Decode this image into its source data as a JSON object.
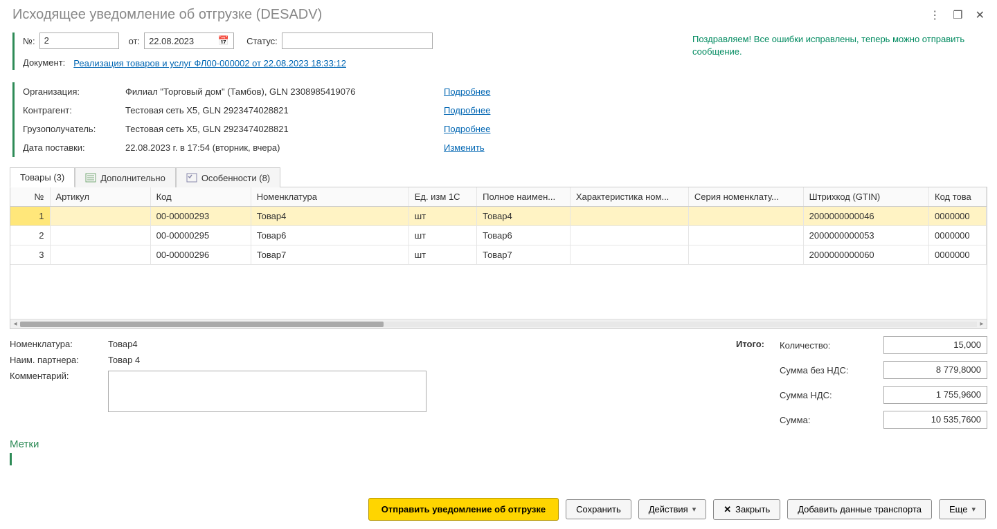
{
  "window": {
    "title": "Исходящее уведомление об отгрузке (DESADV)"
  },
  "header": {
    "num_label": "№:",
    "num_value": "2",
    "from_label": "от:",
    "date_value": "22.08.2023",
    "status_label": "Статус:",
    "status_value": "",
    "congrat": "Поздравляем! Все ошибки исправлены, теперь можно отправить сообщение."
  },
  "doc": {
    "label": "Документ:",
    "link": "Реализация товаров и услуг ФЛ00-000002 от 22.08.2023 18:33:12"
  },
  "info": {
    "org_label": "Организация:",
    "org_value": "Филиал \"Торговый дом\" (Тамбов), GLN 2308985419076",
    "counter_label": "Контрагент:",
    "counter_value": "Тестовая сеть X5, GLN 2923474028821",
    "consignee_label": "Грузополучатель:",
    "consignee_value": "Тестовая сеть X5, GLN 2923474028821",
    "delivery_label": "Дата поставки:",
    "delivery_value": "22.08.2023 г. в 17:54 (вторник, вчера)",
    "more": "Подробнее",
    "change": "Изменить"
  },
  "tabs": {
    "goods": "Товары (3)",
    "extra": "Дополнительно",
    "features": "Особенности (8)"
  },
  "table": {
    "cols": [
      "№",
      "Артикул",
      "Код",
      "Номенклатура",
      "Ед. изм 1С",
      "Полное наимен...",
      "Характеристика ном...",
      "Серия номенклату...",
      "Штрихкод (GTIN)",
      "Код това"
    ],
    "rows": [
      {
        "n": "1",
        "art": "",
        "code": "00-00000293",
        "nom": "Товар4",
        "unit": "шт",
        "full": "Товар4",
        "char": "",
        "series": "",
        "gtin": "2000000000046",
        "pcode": "0000000"
      },
      {
        "n": "2",
        "art": "",
        "code": "00-00000295",
        "nom": "Товар6",
        "unit": "шт",
        "full": "Товар6",
        "char": "",
        "series": "",
        "gtin": "2000000000053",
        "pcode": "0000000"
      },
      {
        "n": "3",
        "art": "",
        "code": "00-00000296",
        "nom": "Товар7",
        "unit": "шт",
        "full": "Товар7",
        "char": "",
        "series": "",
        "gtin": "2000000000060",
        "pcode": "0000000"
      }
    ]
  },
  "bottom": {
    "nom_label": "Номенклатура:",
    "nom_value": "Товар4",
    "partner_label": "Наим. партнера:",
    "partner_value": "Товар 4",
    "comment_label": "Комментарий:",
    "comment_value": ""
  },
  "totals": {
    "title": "Итого:",
    "qty_label": "Количество:",
    "qty_value": "15,000",
    "sum_novat_label": "Сумма без НДС:",
    "sum_novat_value": "8 779,8000",
    "vat_label": "Сумма НДС:",
    "vat_value": "1 755,9600",
    "sum_label": "Сумма:",
    "sum_value": "10 535,7600"
  },
  "labels_section": {
    "title": "Метки"
  },
  "footer": {
    "send": "Отправить уведомление об отгрузке",
    "save": "Сохранить",
    "actions": "Действия",
    "close": "Закрыть",
    "add_transport": "Добавить данные транспорта",
    "more": "Еще"
  }
}
